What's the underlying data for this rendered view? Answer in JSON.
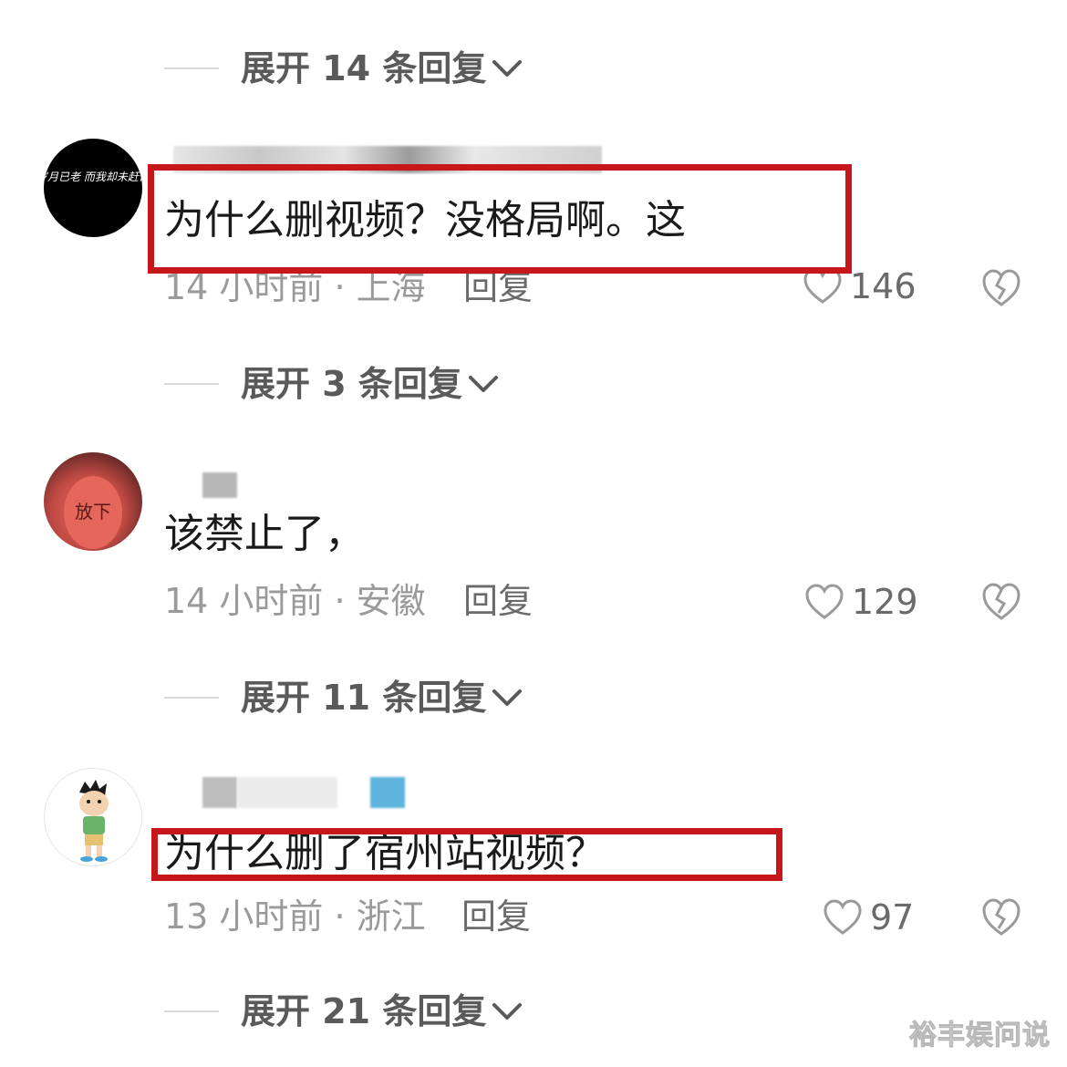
{
  "thread": [
    {
      "expand_label": "展开 14 条回复"
    },
    {
      "comment_text": "为什么删视频？没格局啊。这",
      "time_location": "14 小时前 · 上海",
      "reply_label": "回复",
      "like_count": "146"
    },
    {
      "expand_label": "展开 3 条回复"
    },
    {
      "comment_text": "该禁止了，",
      "time_location": "14 小时前 · 安徽",
      "reply_label": "回复",
      "like_count": "129"
    },
    {
      "expand_label": "展开 11 条回复"
    },
    {
      "comment_text": "为什么删了宿州站视频？",
      "time_location": "13 小时前 · 浙江",
      "reply_label": "回复",
      "like_count": "97"
    },
    {
      "expand_label": "展开 21 条回复"
    }
  ],
  "avatar1_text": "岁月已老 而我却未赶你",
  "avatar2_text": "放下",
  "watermark": "裕丰娱问说",
  "colors": {
    "highlight_red": "#c8171a",
    "text_dark": "#1a1a1a",
    "text_gray": "#9a9a9a",
    "icon_gray": "#6a6a6a"
  },
  "icons": [
    "chevron-down-icon",
    "heart-icon",
    "broken-heart-icon"
  ]
}
